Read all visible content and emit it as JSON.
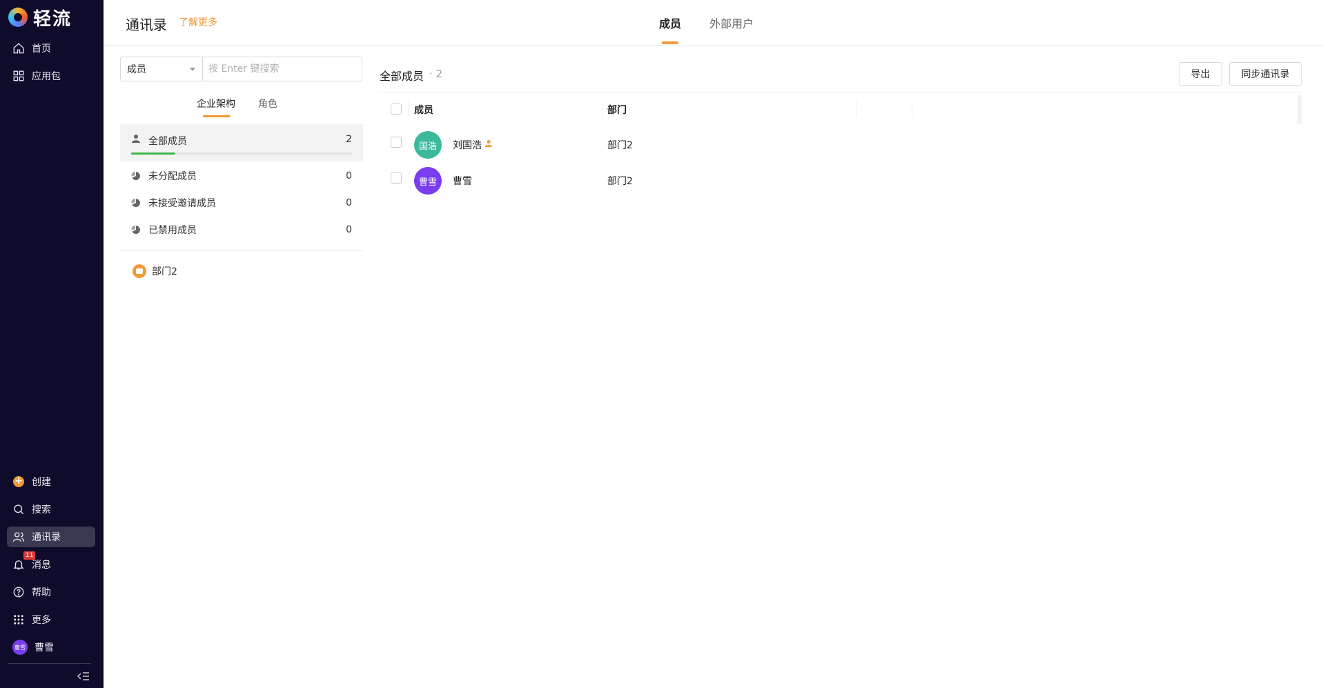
{
  "app": {
    "logo_text": "轻流"
  },
  "sidebar": {
    "top_items": [
      {
        "label": "首页",
        "icon": "home-icon"
      },
      {
        "label": "应用包",
        "icon": "grid-icon"
      }
    ],
    "bottom_items": [
      {
        "label": "创建",
        "icon": "plus-circle-icon"
      },
      {
        "label": "搜索",
        "icon": "search-icon"
      },
      {
        "label": "通讯录",
        "icon": "contacts-icon",
        "active": true
      },
      {
        "label": "消息",
        "icon": "bell-icon",
        "badge": "11"
      },
      {
        "label": "帮助",
        "icon": "help-icon"
      },
      {
        "label": "更多",
        "icon": "more-icon"
      }
    ],
    "user": {
      "avatar_text": "曹雪",
      "name": "曹雪"
    }
  },
  "header": {
    "title": "通讯录",
    "learn_more": "了解更多",
    "tabs": [
      {
        "label": "成员",
        "active": true
      },
      {
        "label": "外部用户",
        "active": false
      }
    ]
  },
  "left_panel": {
    "filter_select": {
      "value": "成员"
    },
    "search": {
      "value": "",
      "placeholder": "按 Enter 键搜索"
    },
    "sub_tabs": [
      {
        "label": "企业架构",
        "active": true
      },
      {
        "label": "角色",
        "active": false
      }
    ],
    "groups": [
      {
        "label": "全部成员",
        "count": "2",
        "progress": 0.2,
        "active": true
      },
      {
        "label": "未分配成员",
        "count": "0"
      },
      {
        "label": "未接受邀请成员",
        "count": "0"
      },
      {
        "label": "已禁用成员",
        "count": "0"
      }
    ],
    "departments": [
      {
        "label": "部门2"
      }
    ]
  },
  "main": {
    "list_title": "全部成员",
    "list_count": "· 2",
    "buttons": {
      "export": "导出",
      "sync": "同步通讯录"
    },
    "columns": [
      "成员",
      "部门"
    ],
    "rows": [
      {
        "avatar_text": "国浩",
        "avatar_color": "#3cb89a",
        "name": "刘国浩",
        "is_admin": true,
        "department": "部门2"
      },
      {
        "avatar_text": "曹雪",
        "avatar_color": "#7a3df0",
        "name": "曹雪",
        "is_admin": false,
        "department": "部门2"
      }
    ]
  },
  "colors": {
    "accent": "#f09a36",
    "sidebar_bg": "#0f0b2b",
    "progress": "#3cb84a"
  }
}
